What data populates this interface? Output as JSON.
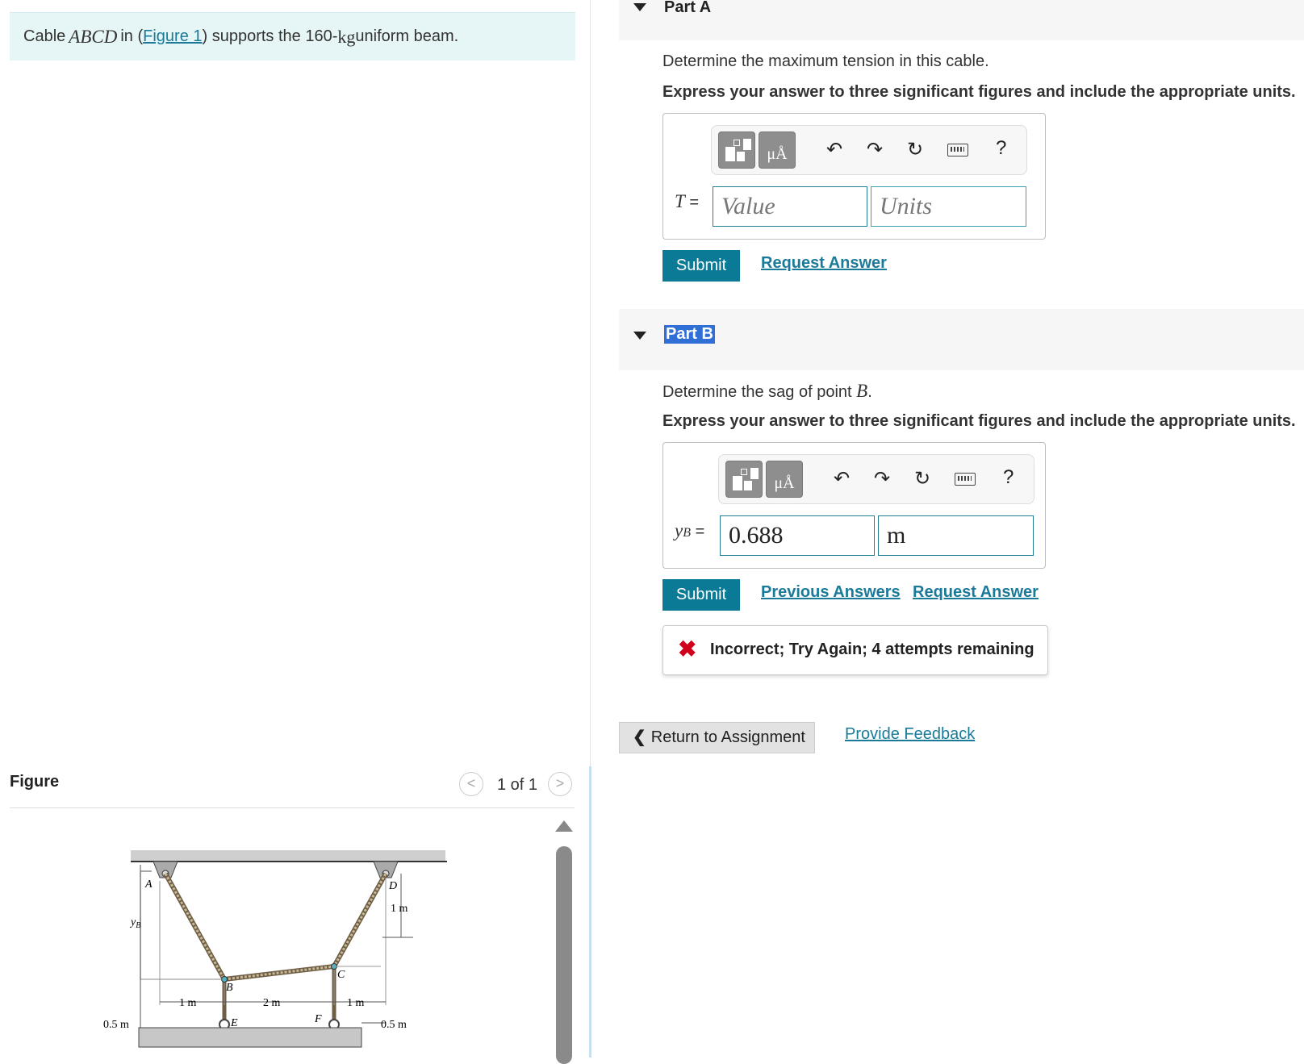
{
  "problem": {
    "prefix": "Cable",
    "cable_name": "ABCD",
    "in_text": "in (",
    "figure_link": "Figure 1",
    "after_link": ") supports the 160-",
    "unit": "kg",
    "suffix": " uniform beam."
  },
  "figure": {
    "title": "Figure",
    "pager_text": "1 of 1",
    "prev": "<",
    "next": ">",
    "labels": {
      "A": "A",
      "B": "B",
      "C": "C",
      "D": "D",
      "E": "E",
      "F": "F",
      "yB": "y",
      "yB_sub": "B",
      "one_m_right": "1 m",
      "half_m_left": "0.5 m",
      "half_m_right": "0.5 m",
      "dim_1m_a": "1 m",
      "dim_2m": "2 m",
      "dim_1m_b": "1 m"
    }
  },
  "partA": {
    "title": "Part A",
    "question": "Determine the maximum tension in this cable.",
    "instruction": "Express your answer to three significant figures and include the appropriate units.",
    "var": "T",
    "eq": "=",
    "value_placeholder": "Value",
    "units_placeholder": "Units",
    "submit": "Submit",
    "request_answer": "Request Answer",
    "units_btn": "μÅ",
    "help": "?"
  },
  "partB": {
    "title": "Part B",
    "question_prefix": "Determine the sag of point",
    "question_point": "B",
    "question_suffix": ".",
    "instruction": "Express your answer to three significant figures and include the appropriate units.",
    "var": "y",
    "var_sub": "B",
    "eq": "=",
    "value": "0.688",
    "units": "m",
    "submit": "Submit",
    "previous_answers": "Previous Answers",
    "request_answer": "Request Answer",
    "units_btn": "μÅ",
    "help": "?",
    "feedback_icon": "✖",
    "feedback": "Incorrect; Try Again; 4 attempts remaining"
  },
  "footer": {
    "return": "Return to Assignment",
    "provide_feedback": "Provide Feedback"
  },
  "colors": {
    "accent": "#0b7a96",
    "link": "#1a7a9a",
    "error": "#d0021b",
    "selection": "#2f6fd6",
    "problem_bg": "#e6f5f6"
  }
}
